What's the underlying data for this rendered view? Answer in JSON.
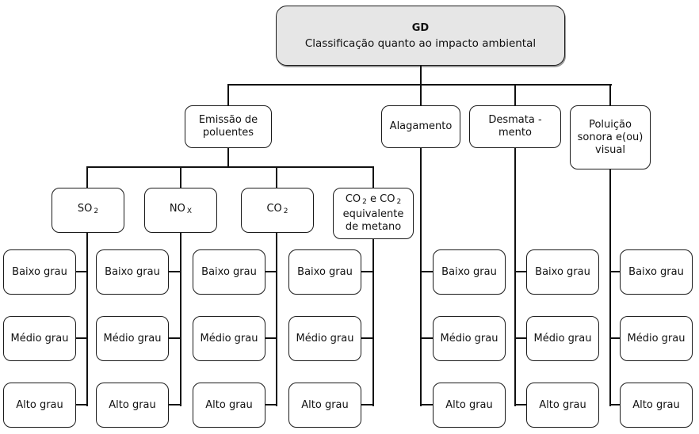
{
  "root": {
    "title": "GD",
    "subtitle": "Classificação quanto ao impacto ambiental"
  },
  "categories": [
    {
      "label": "Emissão de poluentes",
      "lines": [
        "Emissão de",
        "poluentes"
      ]
    },
    {
      "label": "Alagamento",
      "lines": [
        "Alagamento"
      ]
    },
    {
      "label": "Desmatamento",
      "lines": [
        "Desmata -",
        "mento"
      ]
    },
    {
      "label": "Poluição sonora e(ou) visual",
      "lines": [
        "Poluição",
        "sonora e(ou)",
        "visual"
      ]
    }
  ],
  "pollutants": [
    {
      "base": "SO",
      "sub": "2"
    },
    {
      "base": "NO",
      "sub": "X"
    },
    {
      "base": "CO",
      "sub": "2"
    },
    {
      "line1_base": "CO",
      "line1_sub": "2",
      "line1_mid": " e CO",
      "line1_sub2": "2",
      "line2": "equivalente",
      "line3": "de metano"
    }
  ],
  "levels": [
    "Baixo grau",
    "Médio grau",
    "Alto grau"
  ]
}
